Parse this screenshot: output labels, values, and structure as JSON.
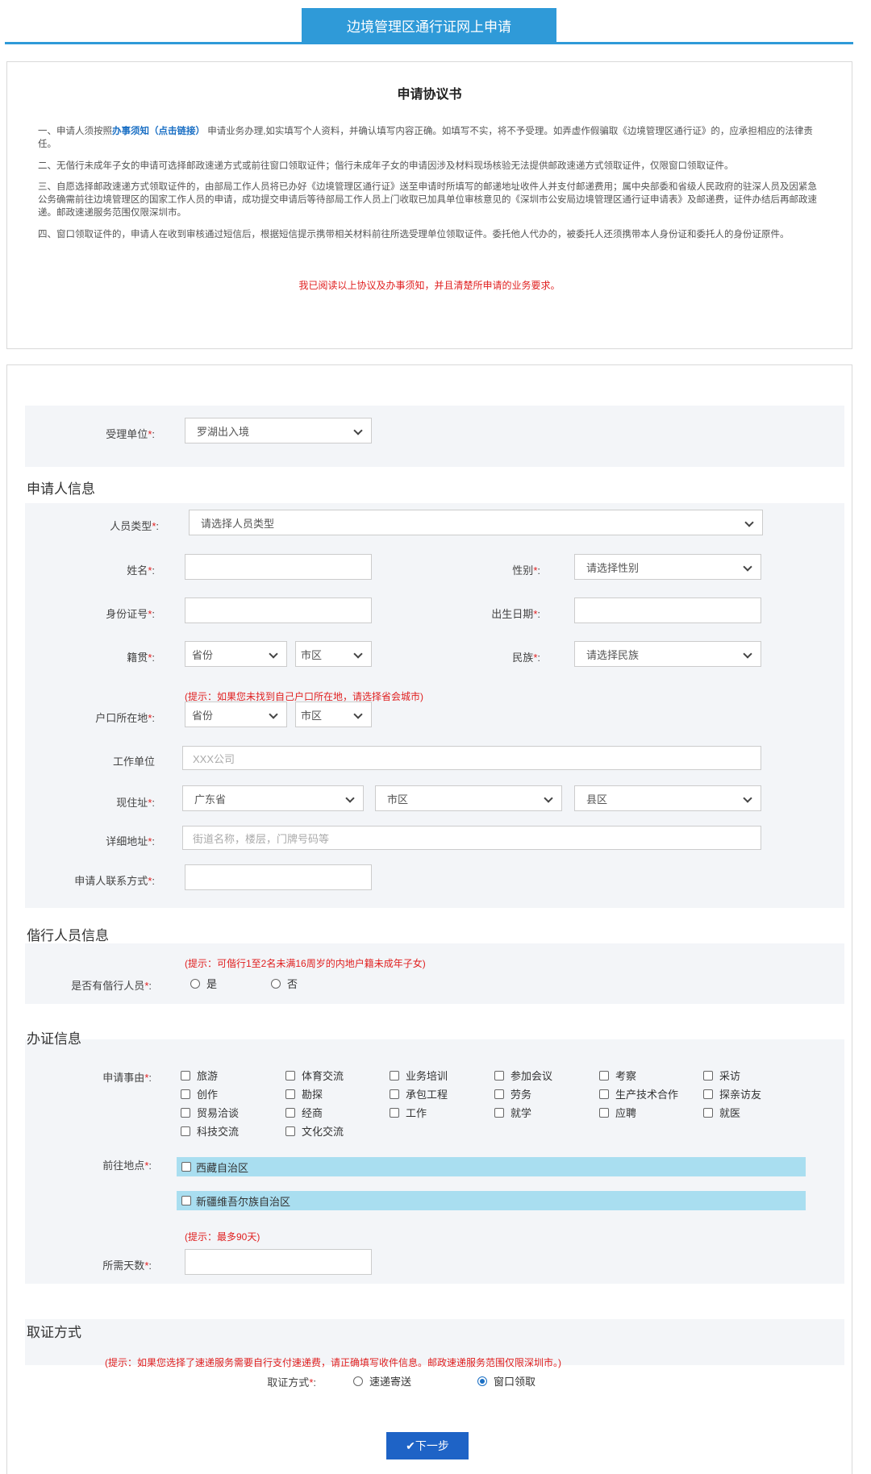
{
  "header": {
    "tab_title": "边境管理区通行证网上申请"
  },
  "agreement": {
    "title": "申请协议书",
    "p1_a": "一、申请人须按照",
    "p1_link": "办事须知（点击链接）",
    "p1_b": "申请业务办理,如实填写个人资料，并确认填写内容正确。如填写不实，将不予受理。如弄虚作假骗取《边境管理区通行证》的，应承担相应的法律责任。",
    "p2": "二、无偕行未成年子女的申请可选择邮政速递方式或前往窗口领取证件；偕行未成年子女的申请因涉及材料现场核验无法提供邮政速递方式领取证件，仅限窗口领取证件。",
    "p3": "三、自愿选择邮政速递方式领取证件的，由部局工作人员将已办好《边境管理区通行证》送至申请时所填写的邮递地址收件人并支付邮递费用；属中央部委和省级人民政府的驻深人员及因紧急公务确需前往边境管理区的国家工作人员的申请，成功提交申请后等待部局工作人员上门收取已加具单位审核意见的《深圳市公安局边境管理区通行证申请表》及邮递费，证件办结后再邮政速递。邮政速递服务范围仅限深圳市。",
    "p4": "四、窗口领取证件的，申请人在收到审核通过短信后，根据短信提示携带相关材料前往所选受理单位领取证件。委托他人代办的，被委托人还须携带本人身份证和委托人的身份证原件。",
    "confirm": "我已阅读以上协议及办事须知，并且清楚所申请的业务要求。"
  },
  "form": {
    "office_label": "受理单位",
    "office_value": "罗湖出入境",
    "sec_applicant": "申请人信息",
    "person_type_label": "人员类型",
    "person_type_value": "请选择人员类型",
    "name_label": "姓名",
    "gender_label": "性别",
    "gender_value": "请选择性别",
    "id_label": "身份证号",
    "birth_label": "出生日期",
    "native_label": "籍贯",
    "province_ph": "省份",
    "city_ph": "市区",
    "ethnic_label": "民族",
    "ethnic_value": "请选择民族",
    "hukou_tip": "(提示：如果您未找到自己户口所在地，请选择省会城市)",
    "hukou_label": "户口所在地",
    "work_label": "工作单位",
    "work_ph": "XXX公司",
    "addr_label": "现住址",
    "addr_province": "广东省",
    "addr_city": "市区",
    "addr_county": "县区",
    "detail_label": "详细地址",
    "detail_ph": "街道名称，楼层，门牌号码等",
    "contact_label": "申请人联系方式",
    "sec_companion": "偕行人员信息",
    "companion_tip": "(提示：可偕行1至2名未满16周岁的内地户籍未成年子女)",
    "companion_label": "是否有偕行人员",
    "yes": "是",
    "no": "否",
    "sec_permit": "办证信息",
    "reason_label": "申请事由",
    "reasons": [
      "旅游",
      "体育交流",
      "业务培训",
      "参加会议",
      "考察",
      "采访",
      "创作",
      "勘探",
      "承包工程",
      "劳务",
      "生产技术合作",
      "探亲访友",
      "贸易洽谈",
      "经商",
      "工作",
      "就学",
      "应聘",
      "就医",
      "科技交流",
      "文化交流"
    ],
    "dest_label": "前往地点",
    "dest1": "西藏自治区",
    "dest2": "新疆维吾尔族自治区",
    "days_tip": "(提示：最多90天)",
    "days_label": "所需天数",
    "sec_pickup": "取证方式",
    "pickup_tip": "(提示：如果您选择了速递服务需要自行支付速递费，请正确填写收件信息。邮政速递服务范围仅限深圳市。)",
    "pickup_label": "取证方式",
    "pickup_express": "速递寄送",
    "pickup_window": "窗口领取",
    "next": "下一步"
  }
}
